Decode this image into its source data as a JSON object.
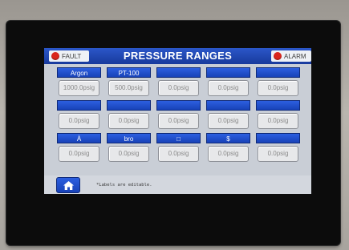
{
  "header": {
    "title": "PRESSURE RANGES",
    "fault_label": "FAULT",
    "alarm_label": "ALARM"
  },
  "ranges": [
    {
      "label": "Argon",
      "value": "1000.0psig"
    },
    {
      "label": "PT-100",
      "value": "500.0psig"
    },
    {
      "label": "",
      "value": "0.0psig"
    },
    {
      "label": "",
      "value": "0.0psig"
    },
    {
      "label": "",
      "value": "0.0psig"
    },
    {
      "label": "",
      "value": "0.0psig"
    },
    {
      "label": "",
      "value": "0.0psig"
    },
    {
      "label": "",
      "value": "0.0psig"
    },
    {
      "label": "",
      "value": "0.0psig"
    },
    {
      "label": "",
      "value": "0.0psig"
    },
    {
      "label": "À",
      "value": "0.0psig"
    },
    {
      "label": "bro",
      "value": "0.0psig"
    },
    {
      "label": "□",
      "value": "0.0psig"
    },
    {
      "label": "$",
      "value": "0.0psig"
    },
    {
      "label": "",
      "value": "0.0psig"
    }
  ],
  "footer": {
    "note": "*Labels are editable."
  },
  "colors": {
    "titlebar": "#1e46b2",
    "button": "#2355d0",
    "indicator_red": "#d9251d",
    "screen_bg": "#c9ced6"
  },
  "icons": {
    "home": "home-icon",
    "fault": "fault-indicator-icon",
    "alarm": "alarm-indicator-icon"
  }
}
